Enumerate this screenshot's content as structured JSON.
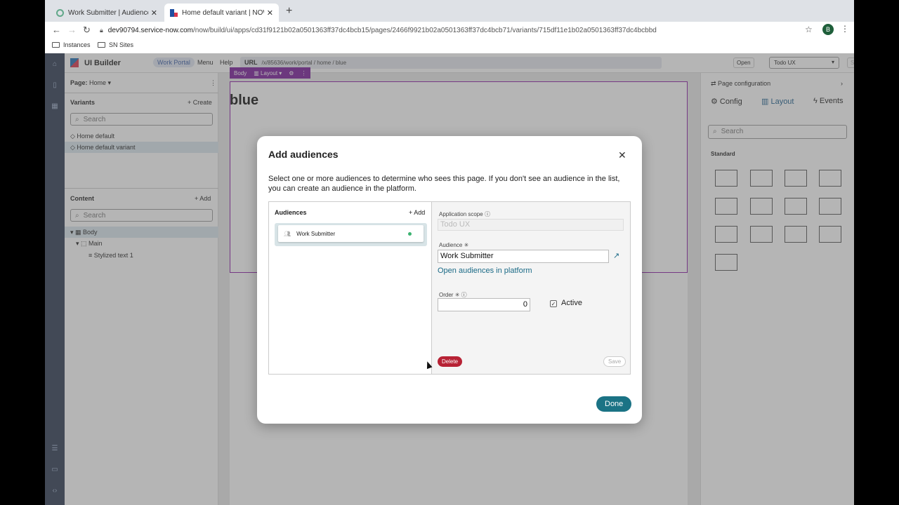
{
  "browser": {
    "tabs": [
      {
        "title": "Work Submitter | Audience | Se"
      },
      {
        "title": "Home default variant | NOW UI"
      }
    ],
    "url_host": "dev90794.service-now.com",
    "url_path": "/now/build/ui/apps/cd31f9121b02a0501363ff37dc4bcb15/pages/2466f9921b02a0501363ff37dc4bcb71/variants/715df11e1b02a0501363ff37dc4bcbbd",
    "avatar_letter": "B",
    "bookmarks": [
      "Instances",
      "SN Sites"
    ]
  },
  "header": {
    "app_name": "UI Builder",
    "portal": "Work Portal",
    "menu": "Menu",
    "help": "Help",
    "url_label": "URL",
    "url_value": "/x/85636/work/portal / home / blue",
    "open": "Open",
    "app_select": "Todo UX",
    "save": "Save"
  },
  "left_panel": {
    "page_label": "Page:",
    "page_value": "Home",
    "variants_title": "Variants",
    "create": "+ Create",
    "search_placeholder": "Search",
    "variants": [
      "Home default",
      "Home default variant"
    ],
    "content_title": "Content",
    "add": "+ Add",
    "tree": [
      "Body",
      "Main",
      "Stylized text 1"
    ]
  },
  "canvas": {
    "toolbar_body": "Body",
    "toolbar_layout": "Layout",
    "heading": "blue"
  },
  "right_panel": {
    "title": "Page configuration",
    "tabs": [
      "Config",
      "Layout",
      "Events"
    ],
    "search_placeholder": "Search",
    "section": "Standard"
  },
  "modal": {
    "title": "Add audiences",
    "description": "Select one or more audiences to determine who sees this page. If you don't see an audience in the list, you can create an audience in the platform.",
    "list_header": "Audiences",
    "list_add": "+ Add",
    "audience_item": "Work Submitter",
    "scope_label": "Application scope",
    "scope_value": "Todo UX",
    "audience_label": "Audience",
    "audience_value": "Work Submitter",
    "open_link": "Open audiences in platform",
    "order_label": "Order",
    "order_value": "0",
    "active_label": "Active",
    "delete": "Delete",
    "save": "Save",
    "done": "Done"
  }
}
